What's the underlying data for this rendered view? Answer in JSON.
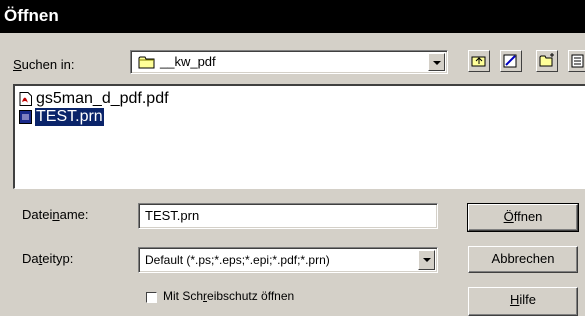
{
  "window": {
    "title": "Öffnen"
  },
  "lookin": {
    "label_pre": "",
    "label_u": "S",
    "label_post": "uchen in:",
    "value": "__kw_pdf",
    "icon": "folder-icon"
  },
  "toolbar": {
    "buttons": [
      {
        "name": "up-one-level-icon"
      },
      {
        "name": "new-folder-icon"
      },
      {
        "name": "list-view-icon"
      },
      {
        "name": "details-view-icon"
      }
    ]
  },
  "files": [
    {
      "name": "gs5man_d_pdf.pdf",
      "icon": "pdf-file-icon",
      "selected": false
    },
    {
      "name": "TEST.prn",
      "icon": "prn-file-icon",
      "selected": true
    }
  ],
  "filename": {
    "label_pre": "Datei",
    "label_u": "n",
    "label_post": "ame:",
    "value": "TEST.prn"
  },
  "filetype": {
    "label_pre": "Da",
    "label_u": "t",
    "label_post": "eityp:",
    "value": "Default (*.ps;*.eps;*.epi;*.pdf;*.prn)"
  },
  "readonly": {
    "label_pre": "Mit Sch",
    "label_u": "r",
    "label_post": "eibschutz öffnen"
  },
  "buttons": {
    "open": {
      "pre": "",
      "u": "Ö",
      "post": "ffnen"
    },
    "cancel": {
      "label": "Abbrechen"
    },
    "help": {
      "pre": "",
      "u": "H",
      "post": "ilfe"
    }
  },
  "colors": {
    "titlebar": "#000000",
    "face": "#d4d0c8",
    "selection": "#0a246a"
  }
}
